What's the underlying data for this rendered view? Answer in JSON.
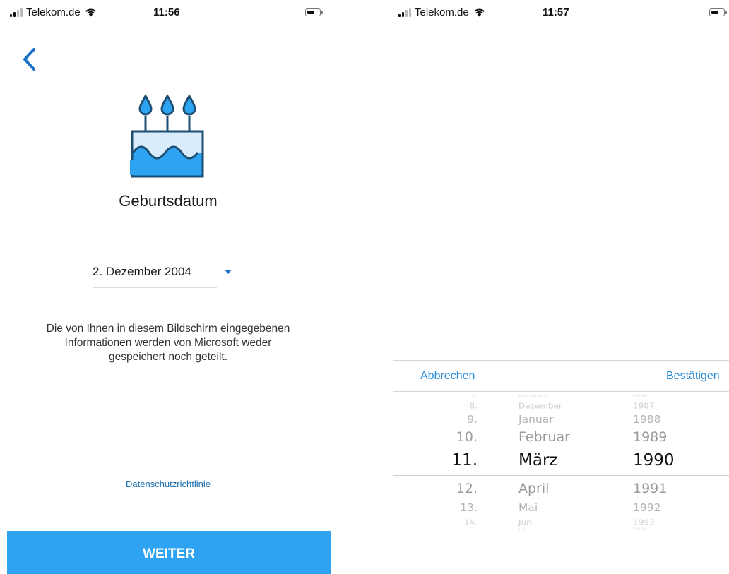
{
  "colors": {
    "accent": "#2ea3f2",
    "link": "#1a6fb0",
    "picker_action": "#2f8ed8",
    "back_chevron": "#1a73c8"
  },
  "left_screen": {
    "status_bar": {
      "carrier": "Telekom.de",
      "time": "11:56"
    },
    "back_icon": "chevron-left-icon",
    "illustration": "birthday-cake-icon",
    "title": "Geburtsdatum",
    "date_field": {
      "value": "2. Dezember 2004"
    },
    "privacy_note": "Die von Ihnen in diesem Bildschirm eingegebenen Informationen werden von Microsoft weder gespeichert noch geteilt.",
    "privacy_link": "Datenschutzrichtlinie",
    "primary_button": "WEITER"
  },
  "right_screen": {
    "status_bar": {
      "carrier": "Telekom.de",
      "time": "11:57"
    },
    "picker": {
      "cancel_label": "Abbrechen",
      "confirm_label": "Bestätigen",
      "days": [
        "8.",
        "9.",
        "10.",
        "11.",
        "12.",
        "13.",
        "14."
      ],
      "months": [
        "Dezember",
        "Januar",
        "Februar",
        "März",
        "April",
        "Mai",
        "Juni"
      ],
      "years": [
        "1987",
        "1988",
        "1989",
        "1990",
        "1991",
        "1992",
        "1993"
      ],
      "selected": {
        "day": "11.",
        "month": "März",
        "year": "1990"
      }
    }
  }
}
